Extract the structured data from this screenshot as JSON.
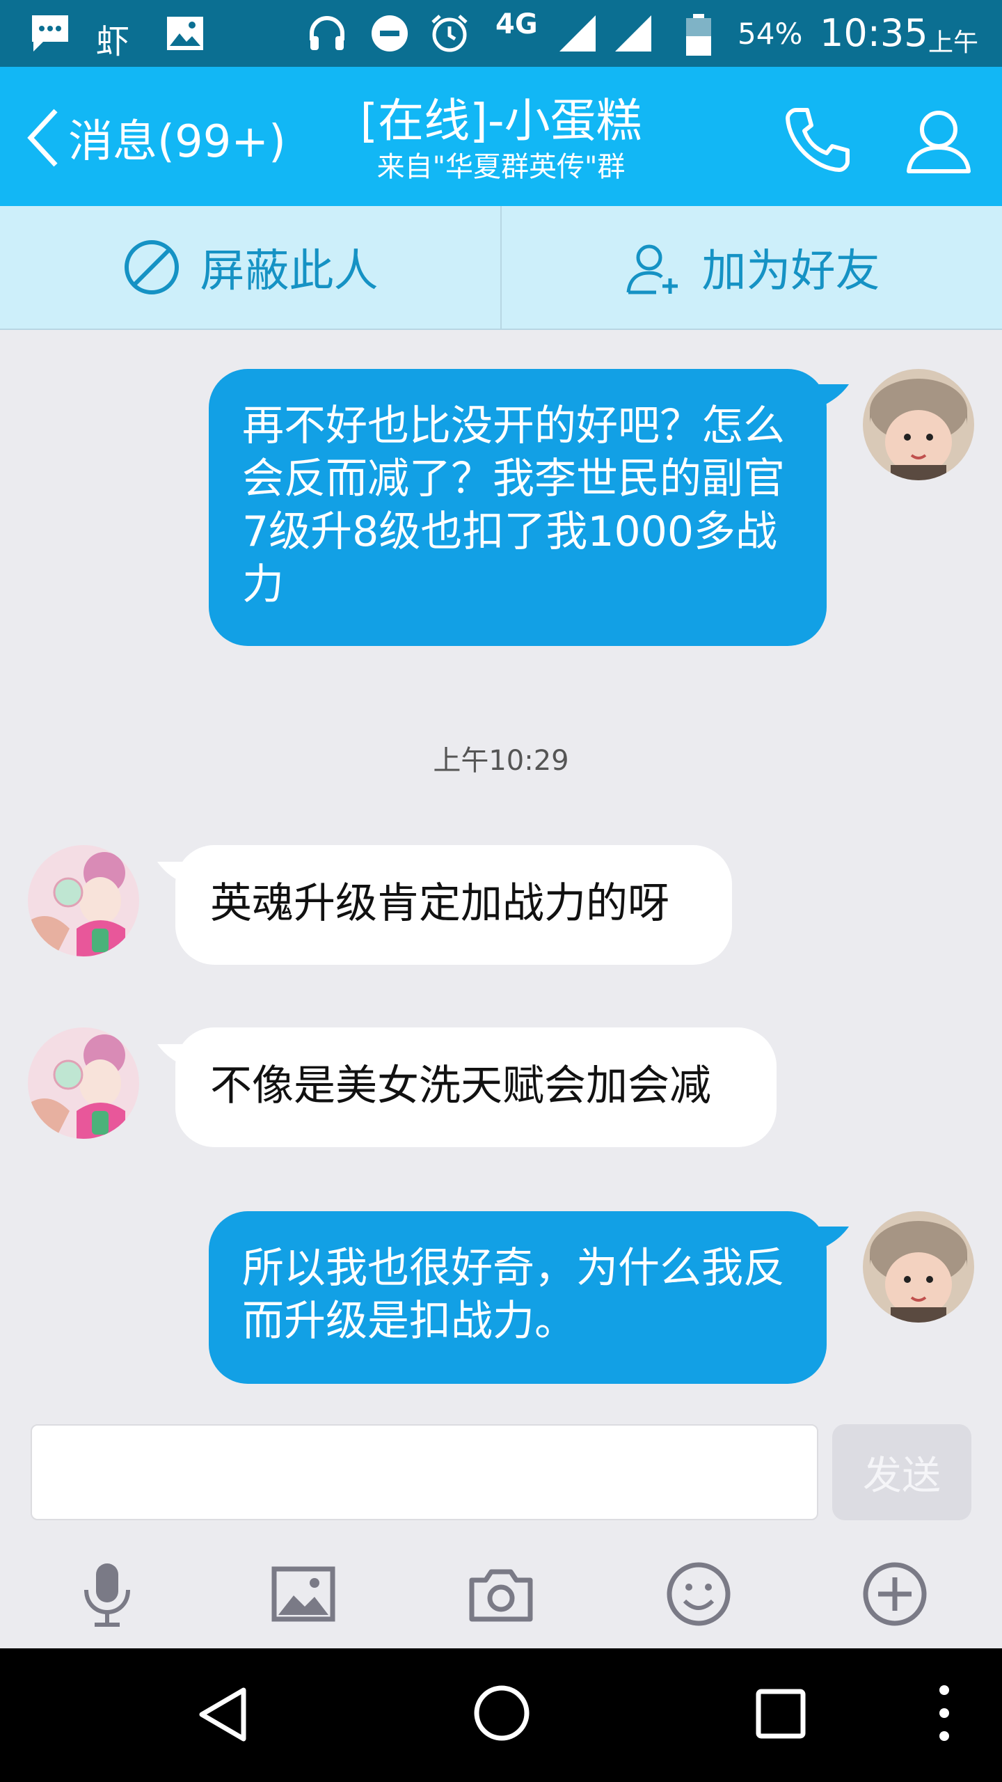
{
  "status_bar": {
    "battery": "54%",
    "time": "10:35",
    "ampm": "上午",
    "network": "4G",
    "app_badge": "虾"
  },
  "header": {
    "back_label": "消息(99+)",
    "title": "[在线]-小蛋糕",
    "subtitle": "来自\"华夏群英传\"群"
  },
  "actions": {
    "block_label": "屏蔽此人",
    "add_friend_label": "加为好友"
  },
  "messages": [
    {
      "direction": "out",
      "text": "再不好也比没开的好吧？怎么会反而减了？我李世民的副官7级升8级也扣了我1000多战力"
    },
    {
      "direction": "in",
      "text": "英魂升级肯定加战力的呀"
    },
    {
      "direction": "in",
      "text": "不像是美女洗天赋会加会减"
    },
    {
      "direction": "out",
      "text": "所以我也很好奇，为什么我反而升级是扣战力。"
    }
  ],
  "timestamp": "上午10:29",
  "input": {
    "value": "",
    "placeholder": "",
    "send_label": "发送"
  },
  "colors": {
    "status_bar": "#0b6f92",
    "header": "#12b7f5",
    "action_bar": "#cdeffa",
    "action_text": "#1592c4",
    "outgoing_bubble": "#12a0e5",
    "incoming_bubble": "#ffffff",
    "chat_background": "#ebebef"
  },
  "toolbar_icons": [
    "microphone-icon",
    "image-icon",
    "camera-icon",
    "emoji-icon",
    "plus-circle-icon"
  ],
  "nav_icons": [
    "back-triangle-icon",
    "home-circle-icon",
    "recents-square-icon",
    "more-dots-icon"
  ]
}
